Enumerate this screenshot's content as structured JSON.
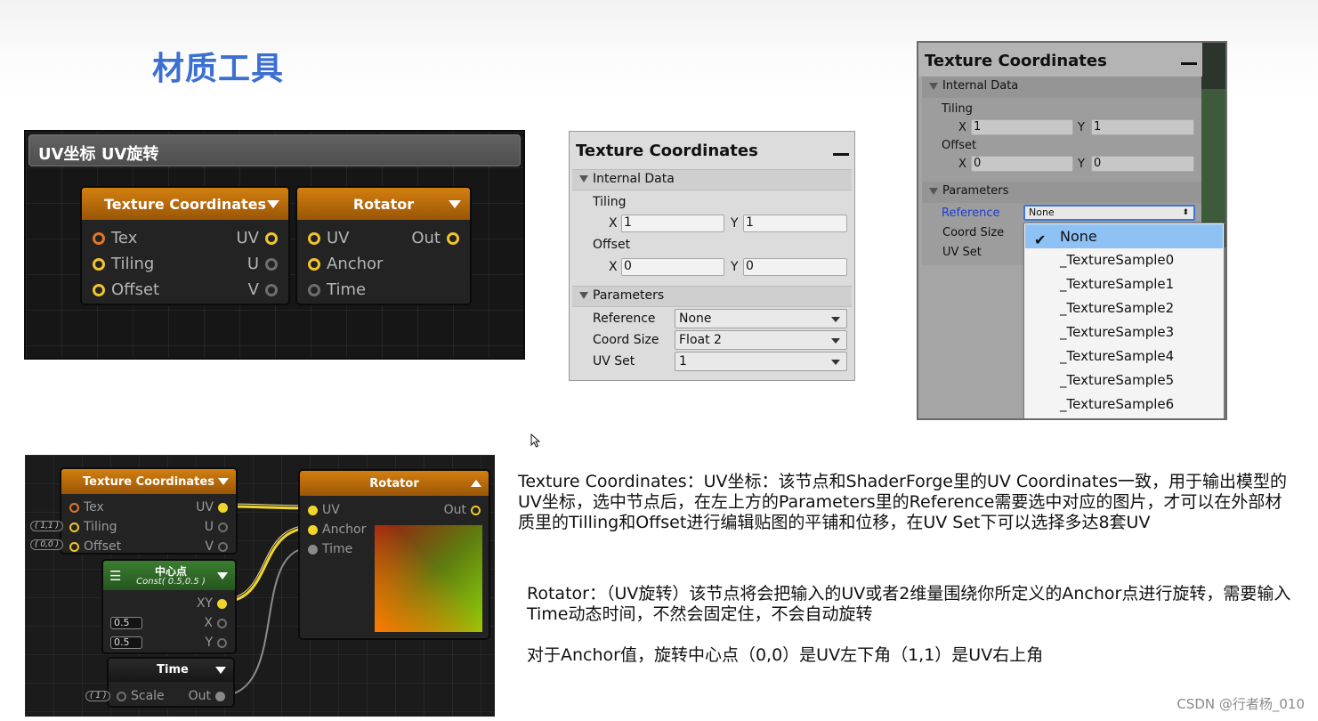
{
  "page": {
    "title": "材质工具",
    "watermark": "CSDN @行者杨_010"
  },
  "panel1": {
    "header": "UV坐标 UV旋转",
    "tex_node": {
      "title": "Texture Coordinates",
      "inputs": [
        "Tex",
        "Tiling",
        "Offset"
      ],
      "outputs": [
        "UV",
        "U",
        "V"
      ]
    },
    "rot_node": {
      "title": "Rotator",
      "inputs": [
        "UV",
        "Anchor",
        "Time"
      ],
      "output": "Out"
    }
  },
  "panel2": {
    "title": "Texture Coordinates",
    "internal_data": "Internal Data",
    "tiling_label": "Tiling",
    "offset_label": "Offset",
    "x_label": "X",
    "y_label": "Y",
    "tiling_x": "1",
    "tiling_y": "1",
    "offset_x": "0",
    "offset_y": "0",
    "parameters": "Parameters",
    "reference_label": "Reference",
    "reference_value": "None",
    "coord_size_label": "Coord Size",
    "coord_size_value": "Float 2",
    "uv_set_label": "UV Set",
    "uv_set_value": "1"
  },
  "panel3": {
    "title": "Texture Coordinates",
    "internal_data": "Internal Data",
    "tiling_label": "Tiling",
    "offset_label": "Offset",
    "x_label": "X",
    "y_label": "Y",
    "tiling_x": "1",
    "tiling_y": "1",
    "offset_x": "0",
    "offset_y": "0",
    "parameters": "Parameters",
    "reference_label": "Reference",
    "reference_value": "None",
    "coord_size_label": "Coord Size",
    "uv_set_label": "UV Set",
    "popup_options": [
      "None",
      "_TextureSample0",
      "_TextureSample1",
      "_TextureSample2",
      "_TextureSample3",
      "_TextureSample4",
      "_TextureSample5",
      "_TextureSample6"
    ],
    "selected_index": 0
  },
  "panel4": {
    "tex_node": {
      "title": "Texture Coordinates",
      "inputs": [
        "Tex",
        "Tiling",
        "Offset"
      ],
      "outputs": [
        "UV",
        "U",
        "V"
      ],
      "tiling_tag": "( 1,1 )",
      "offset_tag": "( 0,0 )"
    },
    "center_node": {
      "title": "中心点",
      "subtitle": "Const( 0.5,0.5 )",
      "output": "XY",
      "x_value": "0.5",
      "y_value": "0.5",
      "x_label": "X",
      "y_label": "Y"
    },
    "time_node": {
      "title": "Time",
      "input": "Scale",
      "output": "Out",
      "scale_tag": "( 1 )"
    },
    "rot_node": {
      "title": "Rotator",
      "inputs": [
        "UV",
        "Anchor",
        "Time"
      ],
      "output": "Out"
    }
  },
  "descriptions": {
    "texcoord": "Texture Coordinates：UV坐标：该节点和ShaderForge里的UV Coordinates一致，用于输出模型的UV坐标，选中节点后，在左上方的Parameters里的Reference需要选中对应的图片，才可以在外部材质里的Tilling和Offset进行编辑贴图的平铺和位移，在UV Set下可以选择多达8套UV",
    "rotator": "Rotator：（UV旋转）该节点将会把输入的UV或者2维量围绕你所定义的Anchor点进行旋转，需要输入Time动态时间，不然会固定住，不会自动旋转",
    "anchor": "对于Anchor值，旋转中心点（0,0）是UV左下角（1,1）是UV右上角"
  },
  "colors": {
    "title_blue": "#3b6fd0",
    "node_orange": "#c87510",
    "port_yellow": "#f0c52a",
    "popup_highlight": "#8ec1f4"
  }
}
